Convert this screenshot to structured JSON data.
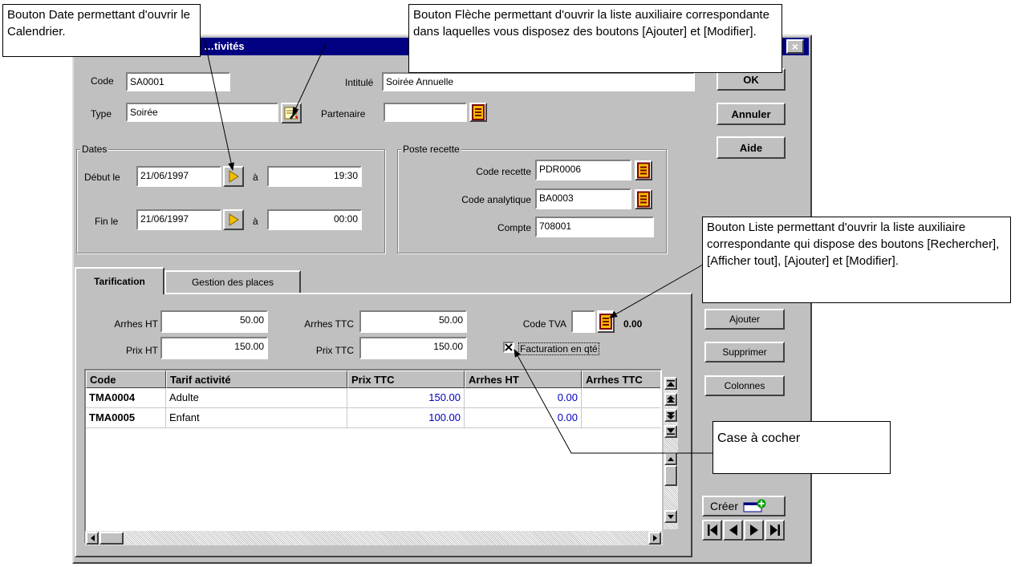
{
  "window": {
    "title": "…tivités",
    "close_glyph": "×"
  },
  "header": {
    "code_label": "Code",
    "code_value": "SA0001",
    "intitule_label": "Intitulé",
    "intitule_value": "Soirée Annuelle",
    "type_label": "Type",
    "type_value": "Soirée",
    "partenaire_label": "Partenaire",
    "partenaire_value": ""
  },
  "buttons": {
    "ok": "OK",
    "annuler": "Annuler",
    "aide": "Aide",
    "ajouter": "Ajouter",
    "supprimer": "Supprimer",
    "colonnes": "Colonnes",
    "creer": "Créer"
  },
  "dates": {
    "group_label": "Dates",
    "debut_label": "Début le",
    "debut_date": "21/06/1997",
    "debut_a": "à",
    "debut_time": "19:30",
    "fin_label": "Fin le",
    "fin_date": "21/06/1997",
    "fin_a": "à",
    "fin_time": "00:00"
  },
  "poste_recette": {
    "group_label": "Poste recette",
    "code_recette_label": "Code recette",
    "code_recette_value": "PDR0006",
    "code_analytique_label": "Code analytique",
    "code_analytique_value": "BA0003",
    "compte_label": "Compte",
    "compte_value": "708001"
  },
  "tabs": [
    {
      "label": "Tarification",
      "active": true
    },
    {
      "label": "Gestion des places",
      "active": false
    }
  ],
  "tarification": {
    "arrhes_ht_label": "Arrhes HT",
    "arrhes_ht_value": "50.00",
    "arrhes_ttc_label": "Arrhes TTC",
    "arrhes_ttc_value": "50.00",
    "code_tva_label": "Code TVA",
    "code_tva_value": "",
    "tva_rate": "0.00",
    "prix_ht_label": "Prix HT",
    "prix_ht_value": "150.00",
    "prix_ttc_label": "Prix TTC",
    "prix_ttc_value": "150.00",
    "facturation_label": "Facturation en qté",
    "facturation_checked": true
  },
  "table": {
    "columns": [
      "Code",
      "Tarif activité",
      "Prix TTC",
      "Arrhes HT",
      "Arrhes TTC"
    ],
    "rows": [
      [
        "TMA0004",
        "Adulte",
        "150.00",
        "0.00",
        ""
      ],
      [
        "TMA0005",
        "Enfant",
        "100.00",
        "0.00",
        ""
      ]
    ]
  },
  "callouts": {
    "date_button": "Bouton Date permettant d'ouvrir le Calendrier.",
    "arrow_button": "Bouton Flèche permettant d'ouvrir la liste auxiliaire correspondante dans laquelles vous disposez des boutons [Ajouter] et [Modifier].",
    "list_button": "Bouton Liste permettant d'ouvrir la liste auxiliaire correspondante qui dispose des boutons [Rechercher], [Afficher tout], [Ajouter] et [Modifier].",
    "checkbox": "Case à cocher"
  },
  "colors": {
    "titlebar": "#000080",
    "window_bg": "#c0c0c0",
    "number_blue": "#0000c0",
    "date_button_yellow": "#f0c000"
  }
}
